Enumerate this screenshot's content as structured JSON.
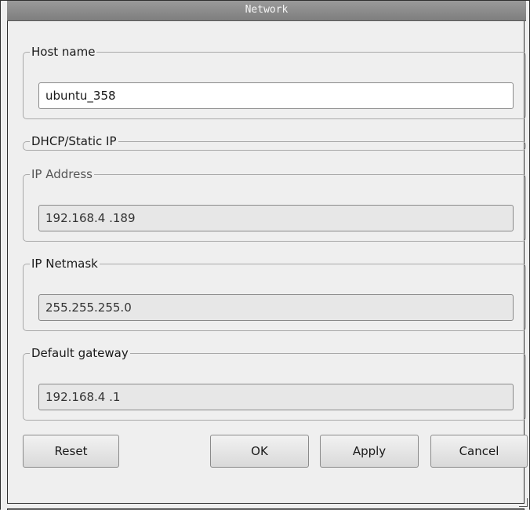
{
  "window": {
    "title": "Network"
  },
  "host_group": {
    "legend": "Host name",
    "host_name_value": "ubuntu_358"
  },
  "dhcp_group": {
    "legend": "DHCP/Static IP"
  },
  "ip_group": {
    "legend": "IP Address",
    "value": "192.168.4  .189"
  },
  "netmask_group": {
    "legend": "IP Netmask",
    "value": "255.255.255.0"
  },
  "gateway_group": {
    "legend": "Default gateway",
    "value": "192.168.4  .1"
  },
  "buttons": {
    "reset": "Reset",
    "ok": "OK",
    "apply": "Apply",
    "cancel": "Cancel"
  }
}
